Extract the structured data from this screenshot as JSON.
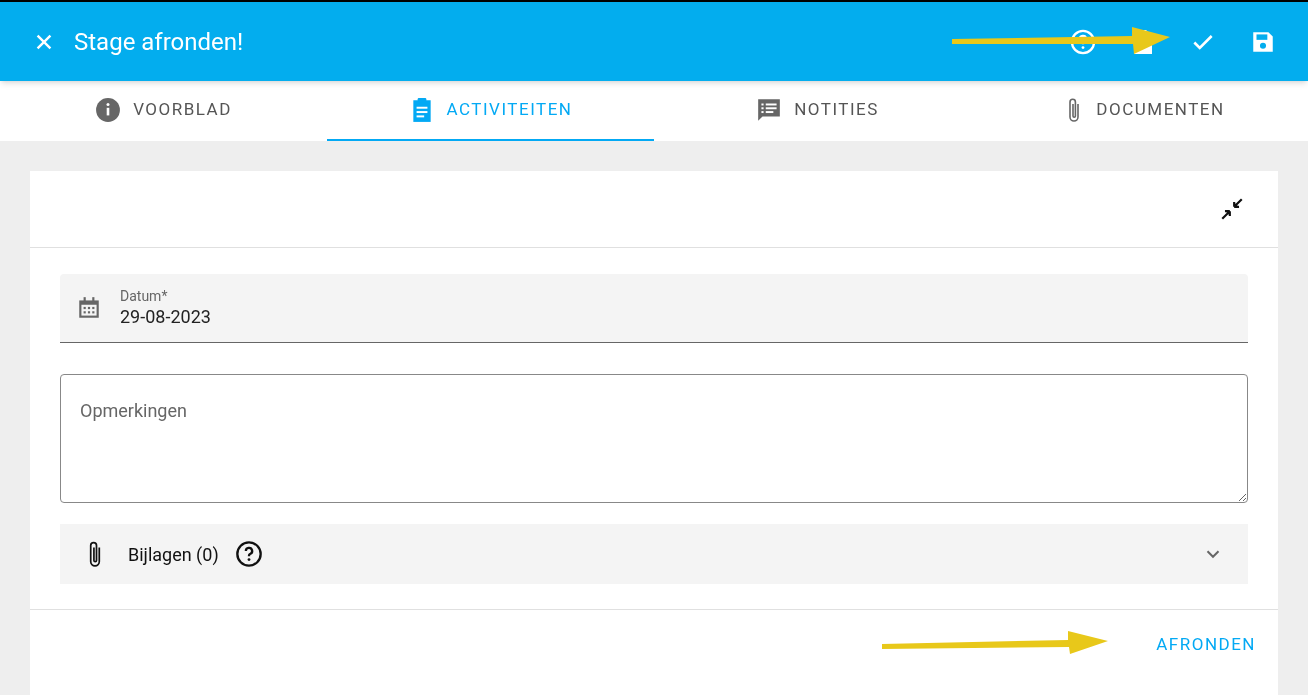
{
  "toolbar": {
    "title": "Stage afronden!"
  },
  "tabs": [
    {
      "label": "VOORBLAD",
      "selected": false
    },
    {
      "label": "ACTIVITEITEN",
      "selected": true
    },
    {
      "label": "NOTITIES",
      "selected": false
    },
    {
      "label": "DOCUMENTEN",
      "selected": false
    }
  ],
  "form": {
    "date_field": {
      "label": "Datum*",
      "value": "29-08-2023"
    },
    "remarks_field": {
      "placeholder": "Opmerkingen"
    },
    "attachments": {
      "label": "Bijlagen (0)",
      "expanded": false
    },
    "submit_button": "AFRONDEN"
  }
}
